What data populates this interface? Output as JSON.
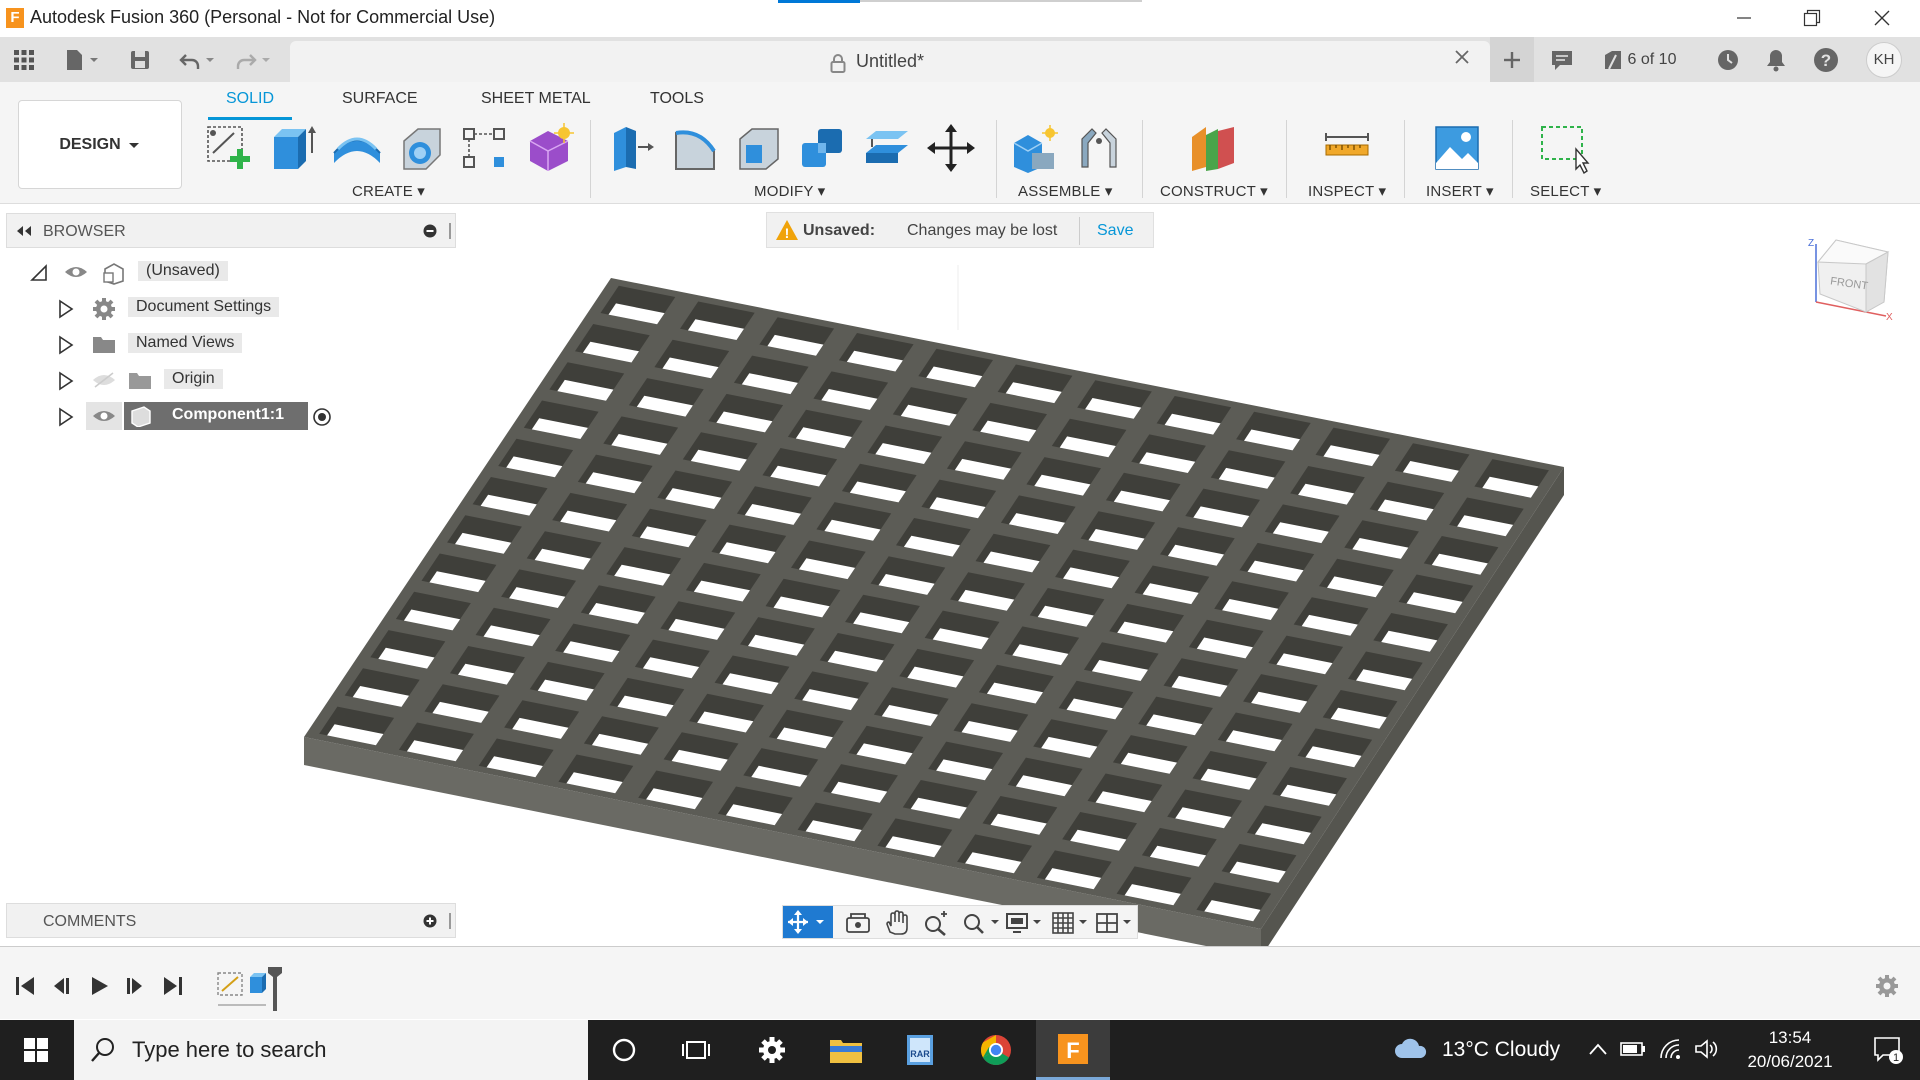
{
  "window": {
    "title": "Autodesk Fusion 360 (Personal - Not for Commercial Use)",
    "logo_letter": "F"
  },
  "document": {
    "tab_name": "Untitled*",
    "jobs_status": "6 of 10",
    "user_initials": "KH"
  },
  "ribbon": {
    "workspace": "DESIGN",
    "tabs": [
      "SOLID",
      "SURFACE",
      "SHEET METAL",
      "TOOLS"
    ],
    "groups": [
      "CREATE",
      "MODIFY",
      "ASSEMBLE",
      "CONSTRUCT",
      "INSPECT",
      "INSERT",
      "SELECT"
    ]
  },
  "browser": {
    "header": "BROWSER",
    "items": [
      {
        "label": "(Unsaved)"
      },
      {
        "label": "Document Settings"
      },
      {
        "label": "Named Views"
      },
      {
        "label": "Origin"
      },
      {
        "label": "Component1:1"
      }
    ]
  },
  "unsaved_bar": {
    "title": "Unsaved:",
    "message": "Changes may be lost",
    "action": "Save"
  },
  "comments": {
    "header": "COMMENTS"
  },
  "viewcube": {
    "face": "FRONT",
    "axis_z": "Z",
    "axis_x": "X"
  },
  "model": {
    "grid_cells": "12 x 12"
  },
  "taskbar": {
    "search_placeholder": "Type here to search",
    "weather": "13°C  Cloudy",
    "time": "13:54",
    "date": "20/06/2021",
    "notification_count": "1"
  },
  "colors": {
    "accent": "#0696d7",
    "grate": "#5c5c56",
    "taskbar": "#1f1f1f",
    "warning": "#f0a30a"
  }
}
